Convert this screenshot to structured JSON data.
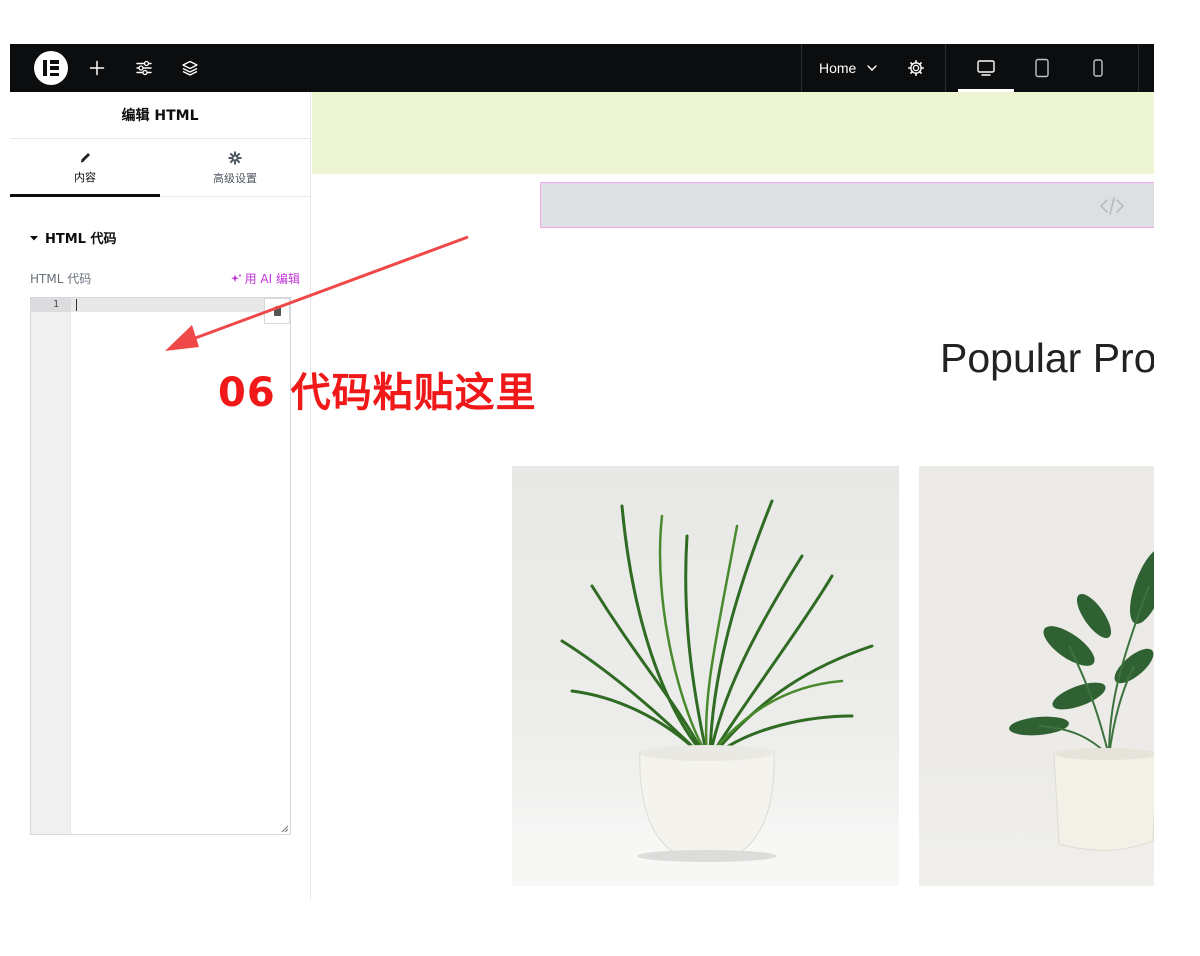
{
  "topbar": {
    "page_selector": "Home",
    "icons": [
      "elementor-logo-icon",
      "plus-icon",
      "sliders-icon",
      "layers-icon",
      "chevron-down-icon",
      "gear-icon",
      "desktop-icon",
      "tablet-icon",
      "mobile-icon"
    ],
    "active_device": "desktop"
  },
  "panel": {
    "title": "编辑 HTML",
    "tabs": [
      {
        "label": "内容",
        "icon": "pencil-icon",
        "active": true
      },
      {
        "label": "高级设置",
        "icon": "gear-icon",
        "active": false
      }
    ],
    "section_title": "HTML 代码",
    "field_label": "HTML 代码",
    "ai_edit_label": "用 AI 编辑",
    "editor": {
      "line_numbers": [
        "1"
      ],
      "content": ""
    }
  },
  "canvas": {
    "heading": "Popular Pro"
  },
  "annotation": {
    "text": "06 代码粘贴这里"
  },
  "colors": {
    "topbar": "#0c0d0e",
    "accent_ai": "#c036d8",
    "band": "#eef5d3",
    "widget_border": "#f0a8ee",
    "annotation": "#f01818"
  }
}
